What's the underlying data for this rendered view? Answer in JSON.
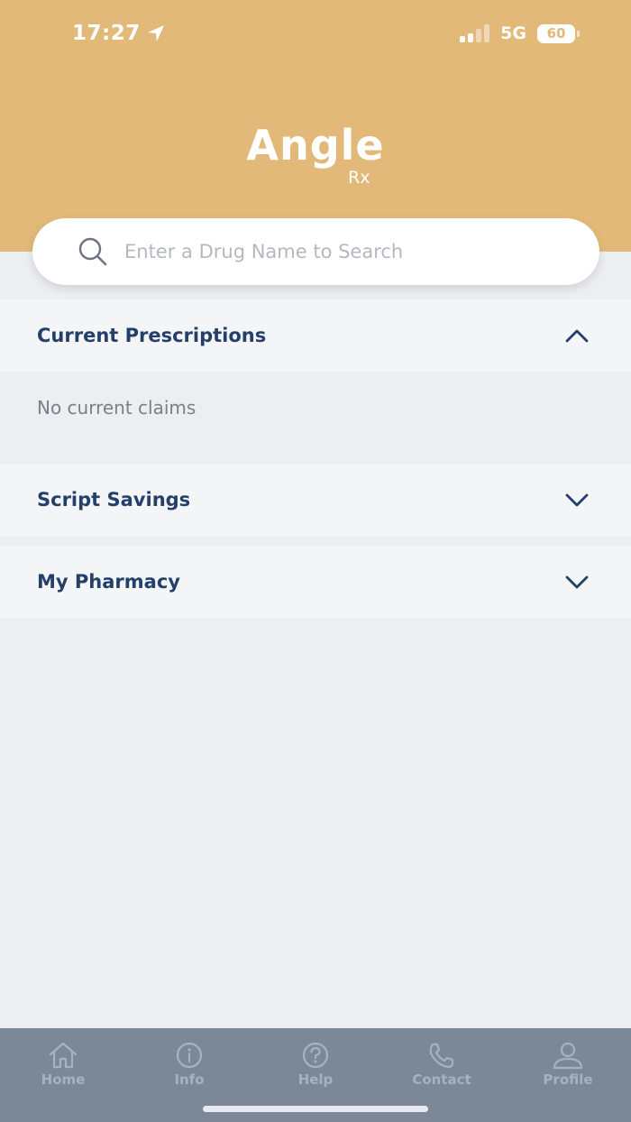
{
  "status_bar": {
    "time": "17:27",
    "network": "5G",
    "battery": "60"
  },
  "header": {
    "logo_main": "Angle",
    "logo_sub": "Rx"
  },
  "search": {
    "placeholder": "Enter a Drug Name to Search"
  },
  "sections": [
    {
      "title": "Current Prescriptions",
      "expanded": true,
      "empty_text": "No current claims"
    },
    {
      "title": "Script Savings",
      "expanded": false
    },
    {
      "title": "My Pharmacy",
      "expanded": false
    }
  ],
  "tab_bar": {
    "items": [
      {
        "label": "Home",
        "icon": "home-icon"
      },
      {
        "label": "Info",
        "icon": "info-icon"
      },
      {
        "label": "Help",
        "icon": "help-icon"
      },
      {
        "label": "Contact",
        "icon": "phone-icon"
      },
      {
        "label": "Profile",
        "icon": "profile-icon"
      }
    ]
  },
  "colors": {
    "header_bg": "#e2b978",
    "page_bg": "#eceef1",
    "section_bg": "#f4f5f7",
    "title_text": "#24406a",
    "tab_bar_bg": "#7c8898"
  }
}
